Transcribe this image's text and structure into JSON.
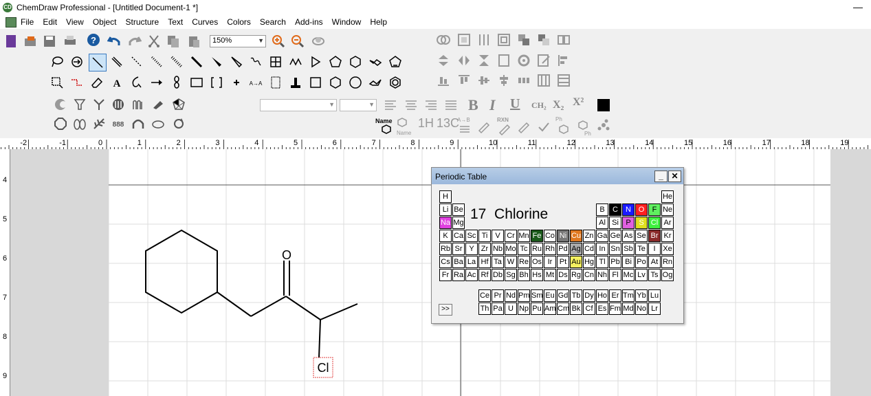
{
  "window": {
    "title": "ChemDraw Professional - [Untitled Document-1 *]",
    "app_icon": "CD",
    "minimize": "—"
  },
  "menu": [
    "File",
    "Edit",
    "View",
    "Object",
    "Structure",
    "Text",
    "Curves",
    "Colors",
    "Search",
    "Add-ins",
    "Window",
    "Help"
  ],
  "toolbar": {
    "zoom": "150%"
  },
  "format_toolbar": {
    "bold": "B",
    "italic": "I",
    "underline": "U",
    "formula": "CH₂",
    "subscript": "X₂",
    "superscript": "X²"
  },
  "tool_labels": {
    "name_tool": "Name",
    "name_tool_sub": "Name",
    "nmr_1h": "1H",
    "nmr_13c": "13C",
    "rxn": "RXN",
    "ph": "Ph",
    "ab": "A→B"
  },
  "ruler": {
    "h": [
      "-2",
      "-1",
      "0",
      "1",
      "2",
      "3",
      "4",
      "5",
      "6",
      "7",
      "8",
      "9",
      "10",
      "11",
      "12",
      "13",
      "14",
      "15",
      "16",
      "17",
      "18",
      "19"
    ],
    "v": [
      "4",
      "5",
      "6",
      "7",
      "8",
      "9"
    ]
  },
  "molecule": {
    "oxygen": "O",
    "chlorine": "Cl"
  },
  "periodic_table": {
    "title": "Periodic Table",
    "selected_number": "17",
    "selected_name": "Chlorine",
    "expand_label": ">>",
    "close": "✕",
    "minimize": "_",
    "rows": [
      [
        "H",
        "",
        "",
        "",
        "",
        "",
        "",
        "",
        "",
        "",
        "",
        "",
        "",
        "",
        "",
        "",
        "",
        "He"
      ],
      [
        "Li",
        "Be",
        "",
        "",
        "",
        "",
        "",
        "",
        "",
        "",
        "",
        "",
        "B",
        "C",
        "N",
        "O",
        "F",
        "Ne"
      ],
      [
        "Na",
        "Mg",
        "",
        "",
        "",
        "",
        "",
        "",
        "",
        "",
        "",
        "",
        "Al",
        "Si",
        "P",
        "S",
        "Cl",
        "Ar"
      ],
      [
        "K",
        "Ca",
        "Sc",
        "Ti",
        "V",
        "Cr",
        "Mn",
        "Fe",
        "Co",
        "Ni",
        "Cu",
        "Zn",
        "Ga",
        "Ge",
        "As",
        "Se",
        "Br",
        "Kr"
      ],
      [
        "Rb",
        "Sr",
        "Y",
        "Zr",
        "Nb",
        "Mo",
        "Tc",
        "Ru",
        "Rh",
        "Pd",
        "Ag",
        "Cd",
        "In",
        "Sn",
        "Sb",
        "Te",
        "I",
        "Xe"
      ],
      [
        "Cs",
        "Ba",
        "La",
        "Hf",
        "Ta",
        "W",
        "Re",
        "Os",
        "Ir",
        "Pt",
        "Au",
        "Hg",
        "Tl",
        "Pb",
        "Bi",
        "Po",
        "At",
        "Rn"
      ],
      [
        "Fr",
        "Ra",
        "Ac",
        "Rf",
        "Db",
        "Sg",
        "Bh",
        "Hs",
        "Mt",
        "Ds",
        "Rg",
        "Cn",
        "Nh",
        "Fl",
        "Mc",
        "Lv",
        "Ts",
        "Og"
      ]
    ],
    "lanthanides": [
      "Ce",
      "Pr",
      "Nd",
      "Pm",
      "Sm",
      "Eu",
      "Gd",
      "Tb",
      "Dy",
      "Ho",
      "Er",
      "Tm",
      "Yb",
      "Lu"
    ],
    "actinides": [
      "Th",
      "Pa",
      "U",
      "Np",
      "Pu",
      "Am",
      "Cm",
      "Bk",
      "Cf",
      "Es",
      "Fm",
      "Md",
      "No",
      "Lr"
    ],
    "colors": {
      "Na": [
        "#e040e0",
        "#fff"
      ],
      "B": [
        "#fff",
        "#000"
      ],
      "C": [
        "#000",
        "#fff"
      ],
      "N": [
        "#1a1aff",
        "#fff"
      ],
      "O": [
        "#ff2020",
        "#fff"
      ],
      "F": [
        "#60f060",
        "#000"
      ],
      "P": [
        "#e060e0",
        "#000"
      ],
      "S": [
        "#e0e020",
        "#fff"
      ],
      "Cl": [
        "#40f040",
        "#fff"
      ],
      "Fe": [
        "#1a5a1a",
        "#fff"
      ],
      "Ni": [
        "#777",
        "#fff"
      ],
      "Cu": [
        "#e07820",
        "#fff"
      ],
      "Ag": [
        "#aaa",
        "#000"
      ],
      "Au": [
        "#f4f060",
        "#000"
      ],
      "Br": [
        "#8a2a2a",
        "#fff"
      ]
    }
  }
}
